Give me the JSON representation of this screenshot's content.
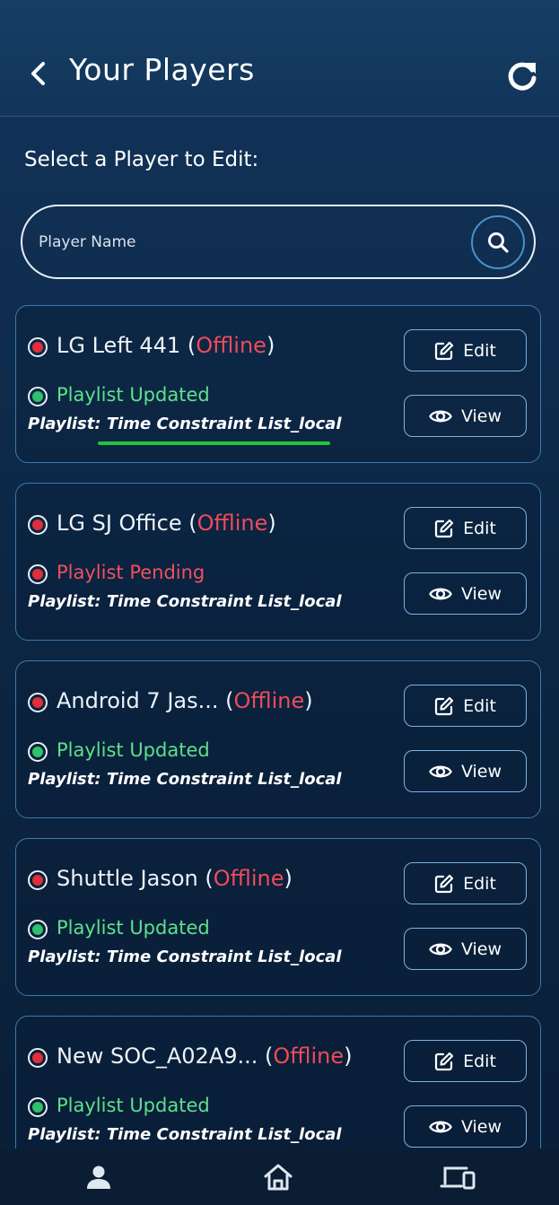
{
  "header": {
    "title": "Your Players",
    "back_icon": "chevron-left-icon",
    "refresh_icon": "refresh-icon"
  },
  "subtitle": "Select a Player to Edit:",
  "search": {
    "placeholder": "Player Name",
    "value": "",
    "icon": "search-icon"
  },
  "players": [
    {
      "name": "LG Left 441",
      "status": "Offline",
      "playlist_status": "Playlist Updated",
      "playlist_state": "updated",
      "playlist_label": "Playlist:",
      "playlist_name": "Time Constraint List_local",
      "edit_label": "Edit",
      "view_label": "View"
    },
    {
      "name": "LG SJ Office",
      "status": "Offline",
      "playlist_status": "Playlist Pending",
      "playlist_state": "pending",
      "playlist_label": "Playlist:",
      "playlist_name": "Time Constraint List_local",
      "edit_label": "Edit",
      "view_label": "View"
    },
    {
      "name": "Android 7 Jas...",
      "status": "Offline",
      "playlist_status": "Playlist Updated",
      "playlist_state": "updated",
      "playlist_label": "Playlist:",
      "playlist_name": "Time Constraint List_local",
      "edit_label": "Edit",
      "view_label": "View"
    },
    {
      "name": "Shuttle Jason",
      "status": "Offline",
      "playlist_status": "Playlist Updated",
      "playlist_state": "updated",
      "playlist_label": "Playlist:",
      "playlist_name": "Time Constraint List_local",
      "edit_label": "Edit",
      "view_label": "View"
    },
    {
      "name": "New SOC_A02A9...",
      "status": "Offline",
      "playlist_status": "Playlist Updated",
      "playlist_state": "updated",
      "playlist_label": "Playlist:",
      "playlist_name": "Time Constraint List_local",
      "edit_label": "Edit",
      "view_label": "View"
    }
  ],
  "bottom_nav": {
    "items": [
      "user-icon",
      "home-icon",
      "devices-icon"
    ]
  },
  "colors": {
    "offline": "#ef4b5a",
    "updated": "#5fe08c",
    "pending": "#f0505e",
    "highlight_underline": "#22c33f",
    "card_border": "#3d79ab"
  }
}
